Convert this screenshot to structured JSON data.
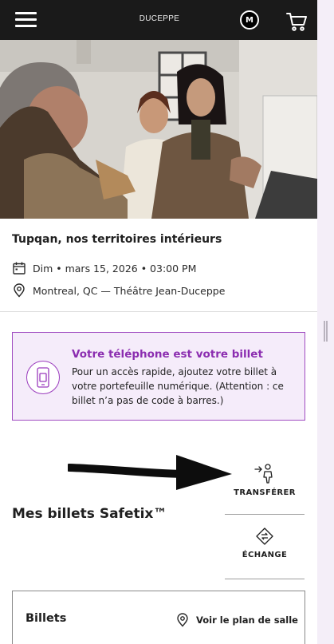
{
  "header": {
    "brand": "DUCEPPE",
    "avatar_initial": "M",
    "menu_icon": "hamburger-menu-icon",
    "cart_icon": "shopping-cart-icon"
  },
  "event": {
    "title": "Tupqan, nos territoires intérieurs",
    "date": "Dim • mars 15, 2026 • 03:00 PM",
    "venue": "Montreal, QC — Théâtre Jean-Duceppe"
  },
  "wallet_banner": {
    "title": "Votre téléphone est votre billet",
    "text": "Pour un accès rapide, ajoutez votre billet à votre portefeuille numérique. (Attention : ce billet n’a pas de code à barres.)"
  },
  "section_title": "Mes billets Safetix™",
  "actions": {
    "transfer": "TRANSFÉRER",
    "exchange": "ÉCHANGE"
  },
  "tickets": {
    "title": "Billets",
    "seat_map_link": "Voir le plan de salle"
  },
  "colors": {
    "header_bg": "#1a1a1a",
    "accent_purple": "#8b2db0",
    "banner_bg": "#f5ecfa",
    "side_panel": "#f4eef8"
  }
}
